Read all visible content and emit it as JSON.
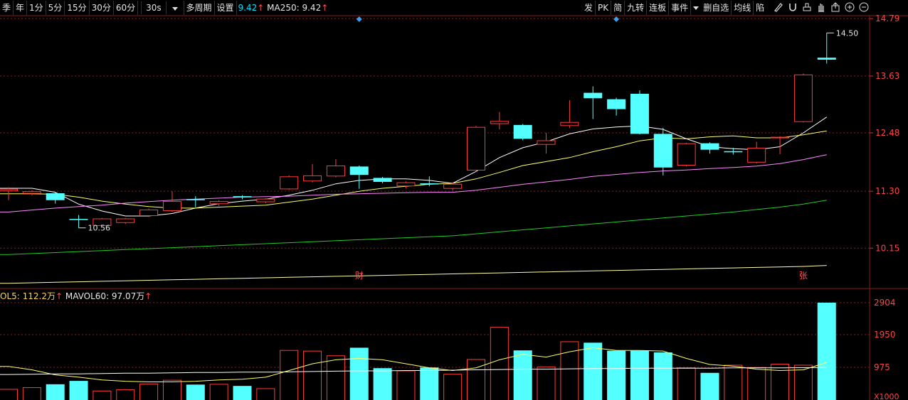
{
  "toolbar": {
    "periods": [
      "季",
      "年",
      "1分",
      "5分",
      "15分",
      "30分",
      "60分"
    ],
    "interval_select": "30s",
    "multi_period": "多周期",
    "settings": "设置",
    "ma_partial_value": "9.42",
    "ma250_label": "MA250: 9.42",
    "right_buttons": [
      "发",
      "PK",
      "简",
      "九转",
      "连板",
      "事件"
    ],
    "self_select": "删自选",
    "ma_lines": "均线",
    "truncated_buttons": [
      "陷"
    ]
  },
  "price_axis": {
    "ticks": [
      "14.79",
      "13.63",
      "12.48",
      "11.30",
      "10.15"
    ]
  },
  "volume_axis": {
    "ticks": [
      "2904",
      "1950",
      "975"
    ],
    "unit": "X1000"
  },
  "annotations": {
    "max_price": "14.50",
    "min_price": "10.56",
    "event_cai": "财",
    "event_zhang": "张"
  },
  "volume_legend": {
    "vol5": "OL5: 112.2万",
    "mavol60": "MAVOL60: 97.07万"
  },
  "colors": {
    "up": "#ff3b3b",
    "down": "#54ffff",
    "ma5": "#ffffff",
    "ma10": "#ffff66",
    "ma20": "#ff88ff",
    "ma60": "#22cc22",
    "ma250": "#ffffaa",
    "grid": "#8b1a1a"
  },
  "chart_data": [
    {
      "type": "candlestick",
      "ylim": [
        9.45,
        14.85
      ],
      "series": [
        {
          "name": "candles",
          "values": [
            {
              "o": 11.3,
              "c": 11.35,
              "h": 11.38,
              "l": 11.12
            },
            {
              "o": 11.25,
              "c": 11.3,
              "h": 11.32,
              "l": 11.22
            },
            {
              "o": 11.26,
              "c": 11.12,
              "h": 11.28,
              "l": 11.05
            },
            {
              "o": 10.74,
              "c": 10.73,
              "h": 10.82,
              "l": 10.56
            },
            {
              "o": 10.6,
              "c": 10.75,
              "h": 10.76,
              "l": 10.6
            },
            {
              "o": 10.66,
              "c": 10.75,
              "h": 10.76,
              "l": 10.64
            },
            {
              "o": 10.8,
              "c": 10.93,
              "h": 10.95,
              "l": 10.78
            },
            {
              "o": 10.9,
              "c": 11.1,
              "h": 11.3,
              "l": 10.88
            },
            {
              "o": 11.14,
              "c": 11.13,
              "h": 11.2,
              "l": 10.98
            },
            {
              "o": 11.04,
              "c": 11.1,
              "h": 11.12,
              "l": 11.0
            },
            {
              "o": 11.2,
              "c": 11.19,
              "h": 11.22,
              "l": 11.14
            },
            {
              "o": 11.08,
              "c": 11.15,
              "h": 11.16,
              "l": 11.06
            },
            {
              "o": 11.34,
              "c": 11.6,
              "h": 11.62,
              "l": 11.33
            },
            {
              "o": 11.5,
              "c": 11.62,
              "h": 11.85,
              "l": 11.48
            },
            {
              "o": 11.6,
              "c": 11.82,
              "h": 11.95,
              "l": 11.58
            },
            {
              "o": 11.8,
              "c": 11.63,
              "h": 11.82,
              "l": 11.35
            },
            {
              "o": 11.57,
              "c": 11.49,
              "h": 11.59,
              "l": 11.46
            },
            {
              "o": 11.4,
              "c": 11.48,
              "h": 11.5,
              "l": 11.36
            },
            {
              "o": 11.46,
              "c": 11.44,
              "h": 11.6,
              "l": 11.4
            },
            {
              "o": 11.35,
              "c": 11.45,
              "h": 11.48,
              "l": 11.32
            },
            {
              "o": 11.72,
              "c": 12.6,
              "h": 12.62,
              "l": 11.7
            },
            {
              "o": 12.66,
              "c": 12.72,
              "h": 12.9,
              "l": 12.55
            },
            {
              "o": 12.64,
              "c": 12.36,
              "h": 12.66,
              "l": 12.33
            },
            {
              "o": 12.24,
              "c": 12.33,
              "h": 12.48,
              "l": 12.06
            },
            {
              "o": 12.62,
              "c": 12.7,
              "h": 13.14,
              "l": 12.58
            },
            {
              "o": 13.29,
              "c": 13.18,
              "h": 13.42,
              "l": 12.76
            },
            {
              "o": 13.16,
              "c": 12.96,
              "h": 13.19,
              "l": 12.83
            },
            {
              "o": 13.27,
              "c": 12.46,
              "h": 13.34,
              "l": 12.45
            },
            {
              "o": 12.46,
              "c": 11.78,
              "h": 12.58,
              "l": 11.62
            },
            {
              "o": 11.82,
              "c": 12.27,
              "h": 12.28,
              "l": 11.8
            },
            {
              "o": 12.27,
              "c": 12.14,
              "h": 12.29,
              "l": 12.06
            },
            {
              "o": 12.11,
              "c": 12.1,
              "h": 12.18,
              "l": 12.04
            },
            {
              "o": 11.88,
              "c": 12.18,
              "h": 12.3,
              "l": 11.86
            },
            {
              "o": 12.38,
              "c": 12.4,
              "h": 12.41,
              "l": 12.05
            },
            {
              "o": 12.7,
              "c": 13.66,
              "h": 13.68,
              "l": 12.69
            },
            {
              "o": 14.0,
              "c": 13.96,
              "h": 14.5,
              "l": 13.88
            }
          ]
        },
        {
          "name": "MA5",
          "values": [
            11.36,
            11.36,
            11.28,
            11.04,
            10.9,
            10.8,
            10.8,
            10.85,
            10.96,
            11.05,
            11.1,
            11.14,
            11.22,
            11.32,
            11.45,
            11.52,
            11.55,
            11.55,
            11.52,
            11.46,
            11.7,
            11.98,
            12.18,
            12.3,
            12.46,
            12.56,
            12.6,
            12.62,
            12.55,
            12.36,
            12.2,
            12.16,
            12.14,
            12.2,
            12.48,
            12.8
          ]
        },
        {
          "name": "MA10",
          "values": [
            11.25,
            11.25,
            11.24,
            11.18,
            11.1,
            11.04,
            10.99,
            10.96,
            10.96,
            10.98,
            11.0,
            11.02,
            11.08,
            11.14,
            11.22,
            11.3,
            11.36,
            11.4,
            11.44,
            11.46,
            11.55,
            11.68,
            11.82,
            11.9,
            11.98,
            12.1,
            12.2,
            12.32,
            12.38,
            12.36,
            12.4,
            12.42,
            12.38,
            12.38,
            12.44,
            12.52
          ]
        },
        {
          "name": "MA20",
          "values": [
            10.88,
            10.92,
            10.96,
            10.99,
            11.02,
            11.06,
            11.09,
            11.12,
            11.14,
            11.16,
            11.18,
            11.19,
            11.2,
            11.22,
            11.24,
            11.25,
            11.26,
            11.27,
            11.28,
            11.28,
            11.32,
            11.38,
            11.44,
            11.49,
            11.54,
            11.6,
            11.64,
            11.68,
            11.71,
            11.73,
            11.76,
            11.78,
            11.81,
            11.86,
            11.94,
            12.04
          ]
        },
        {
          "name": "MA60",
          "values": [
            10.02,
            10.04,
            10.06,
            10.08,
            10.1,
            10.12,
            10.14,
            10.16,
            10.18,
            10.2,
            10.22,
            10.24,
            10.26,
            10.28,
            10.3,
            10.32,
            10.34,
            10.36,
            10.38,
            10.4,
            10.44,
            10.48,
            10.52,
            10.56,
            10.6,
            10.64,
            10.68,
            10.72,
            10.76,
            10.8,
            10.84,
            10.88,
            10.93,
            10.98,
            11.04,
            11.12
          ]
        },
        {
          "name": "MA250",
          "values": [
            9.44,
            9.45,
            9.46,
            9.47,
            9.48,
            9.49,
            9.5,
            9.51,
            9.52,
            9.53,
            9.54,
            9.55,
            9.56,
            9.57,
            9.58,
            9.59,
            9.6,
            9.61,
            9.62,
            9.63,
            9.64,
            9.65,
            9.66,
            9.67,
            9.68,
            9.69,
            9.7,
            9.71,
            9.72,
            9.73,
            9.74,
            9.75,
            9.76,
            9.77,
            9.78,
            9.8
          ]
        }
      ]
    },
    {
      "type": "bar",
      "ylim": [
        0,
        2904
      ],
      "series": [
        {
          "name": "volume",
          "values": [
            330,
            380,
            470,
            570,
            280,
            320,
            490,
            600,
            460,
            480,
            420,
            350,
            1490,
            1470,
            1330,
            1560,
            950,
            880,
            970,
            780,
            1220,
            2180,
            1480,
            1000,
            1750,
            1710,
            1470,
            1470,
            1420,
            970,
            810,
            1050,
            980,
            1080,
            1050,
            2904
          ],
          "up": [
            true,
            true,
            false,
            false,
            true,
            true,
            true,
            true,
            false,
            true,
            false,
            true,
            true,
            true,
            true,
            false,
            false,
            true,
            false,
            true,
            true,
            true,
            false,
            true,
            true,
            false,
            false,
            false,
            false,
            true,
            false,
            true,
            true,
            true,
            true,
            false
          ]
        },
        {
          "name": "VOL5",
          "values": [
            1000,
            900,
            750,
            680,
            600,
            560,
            540,
            540,
            560,
            600,
            620,
            680,
            880,
            1080,
            1200,
            1240,
            1200,
            1080,
            960,
            880,
            960,
            1200,
            1360,
            1280,
            1440,
            1560,
            1480,
            1480,
            1460,
            1240,
            1060,
            1010,
            920,
            880,
            900,
            1122
          ]
        },
        {
          "name": "MAVOL60",
          "values": [
            760,
            770,
            780,
            780,
            790,
            800,
            800,
            810,
            820,
            820,
            830,
            830,
            840,
            850,
            860,
            870,
            870,
            880,
            880,
            890,
            900,
            910,
            920,
            920,
            930,
            940,
            940,
            950,
            950,
            950,
            950,
            960,
            960,
            960,
            965,
            971
          ]
        }
      ]
    }
  ]
}
